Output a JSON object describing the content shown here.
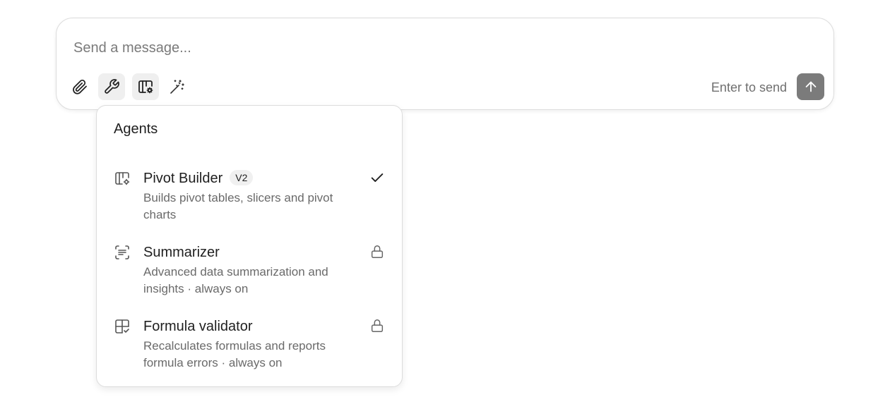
{
  "composer": {
    "placeholder": "Send a message...",
    "enter_hint": "Enter to send",
    "tools": {
      "attach_icon": "paperclip-icon",
      "tools_icon": "wrench-icon",
      "agents_icon": "pivot-table-icon",
      "magic_icon": "magic-wand-icon"
    },
    "send_icon": "arrow-up-icon"
  },
  "agents_menu": {
    "title": "Agents",
    "items": [
      {
        "name": "Pivot Builder",
        "badge": "V2",
        "description": "Builds pivot tables, slicers and pivot charts",
        "icon": "pivot-table-icon",
        "status": "selected"
      },
      {
        "name": "Summarizer",
        "description": "Advanced data summarization and insights · always on",
        "icon": "summarize-icon",
        "status": "locked"
      },
      {
        "name": "Formula validator",
        "description": "Recalculates formulas and reports formula errors · always on",
        "icon": "formula-check-icon",
        "status": "locked"
      }
    ]
  },
  "colors": {
    "send_button": "#7b7b7b",
    "active_tool_bg": "#efefef",
    "border": "#dcdcdc"
  }
}
